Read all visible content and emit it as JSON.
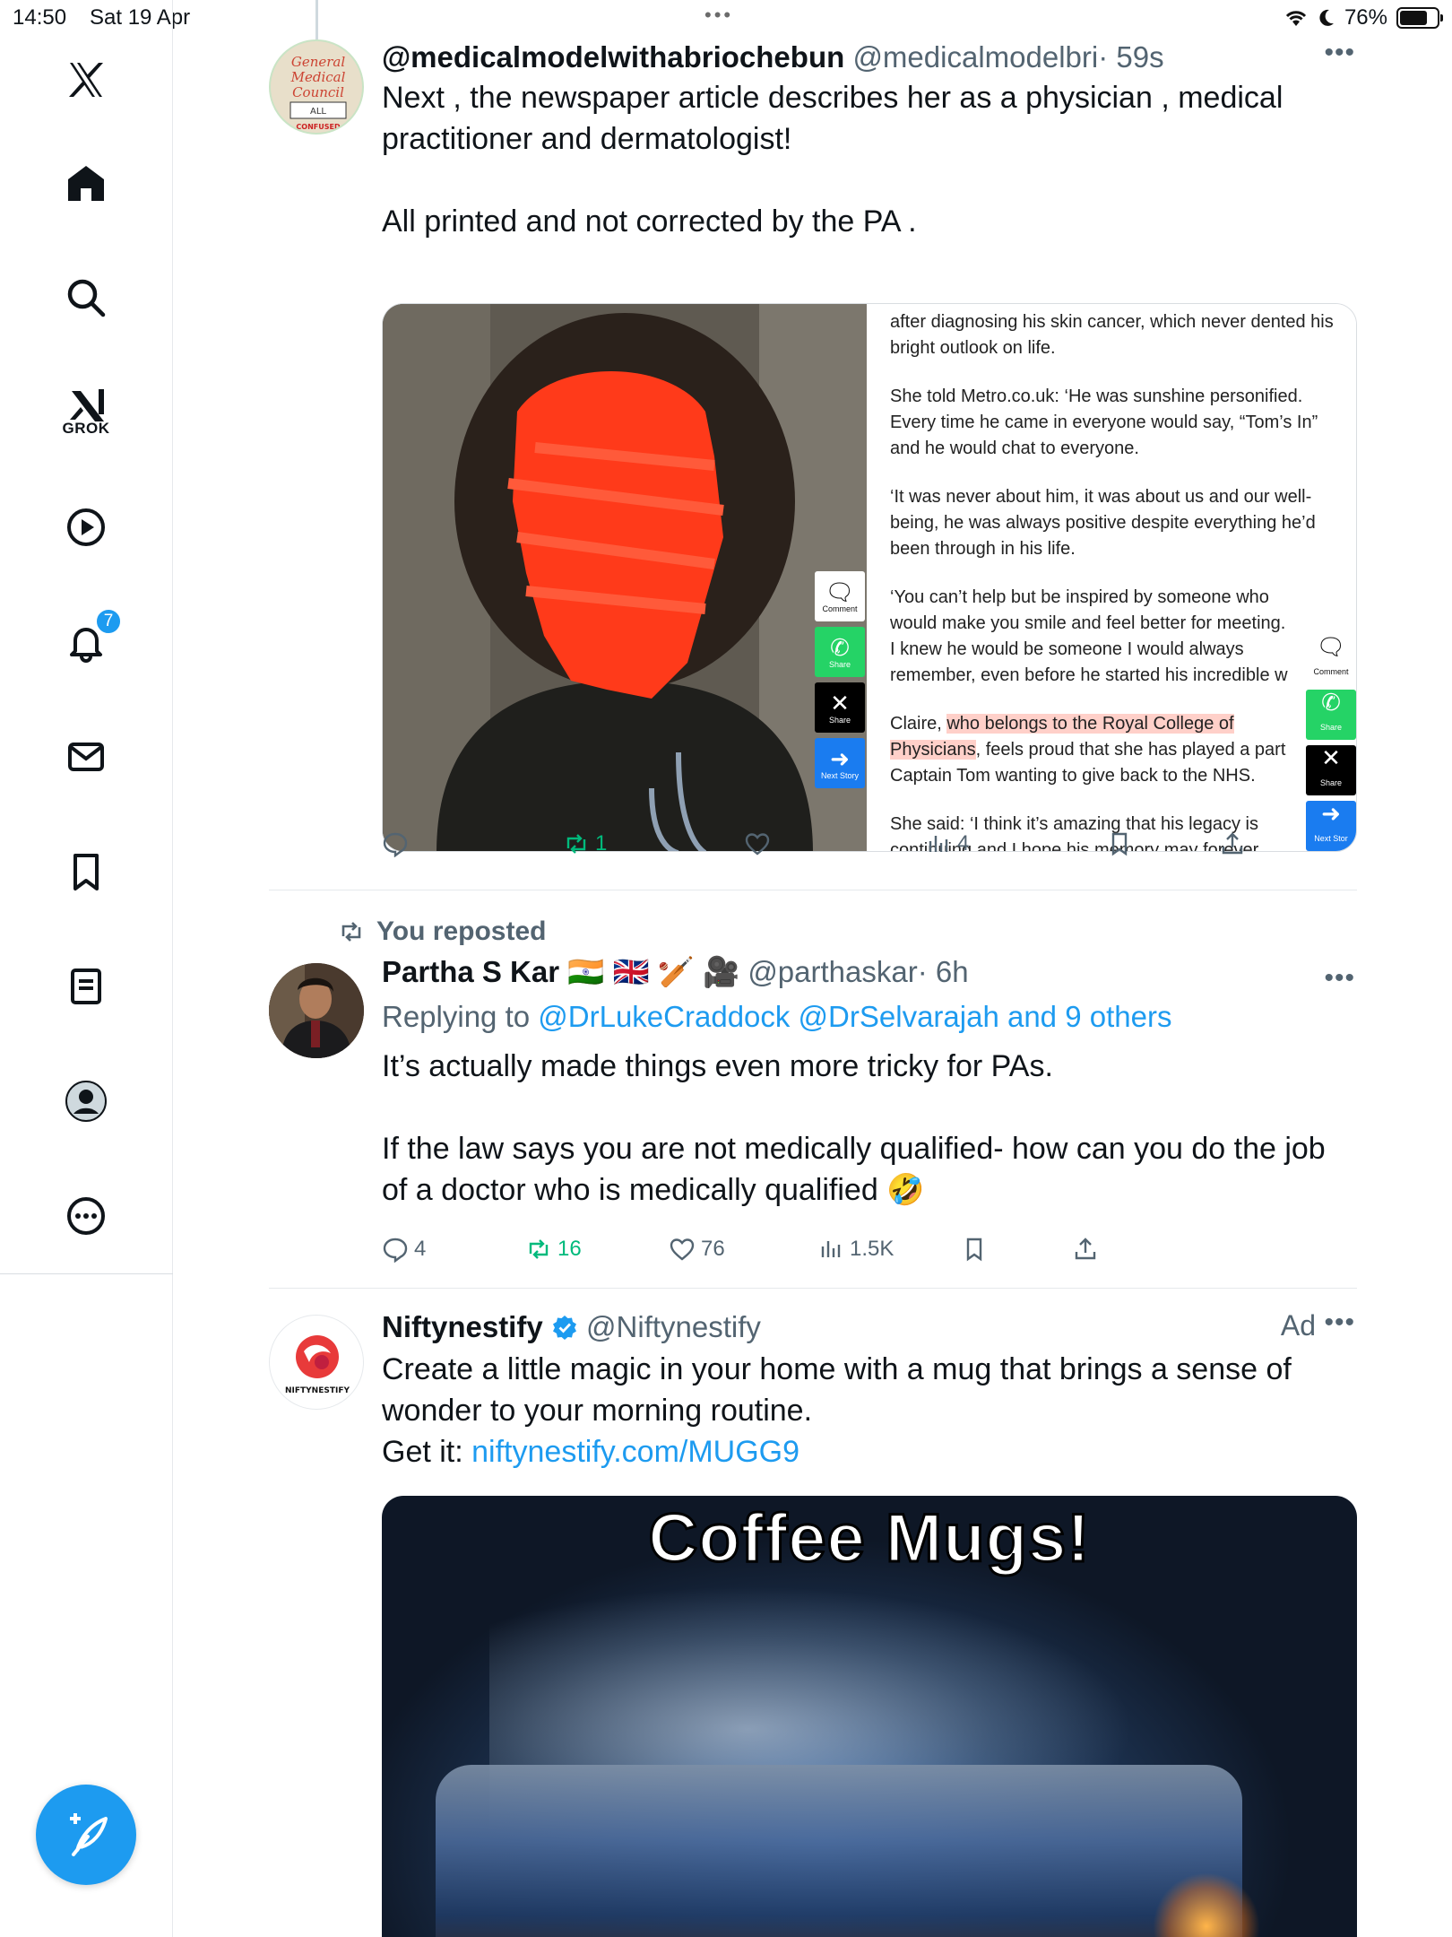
{
  "status_bar": {
    "time": "14:50",
    "date": "Sat 19 Apr",
    "battery": "76%",
    "battery_level": 0.76
  },
  "sidebar": {
    "grok_label": "GROK",
    "notifications_count": "7"
  },
  "tweets": [
    {
      "name": "@medicalmodelwithabriochebun",
      "handle": "@medicalmodelbri",
      "time": "· 59s",
      "text": "Next , the newspaper article describes her as a physician , medical practitioner and dermatologist!\n\nAll printed and not corrected by the PA .",
      "avatar_text": [
        "General",
        "Medical",
        "Council",
        "ALL",
        "CONFUSED"
      ],
      "article": {
        "p1": "after diagnosing his skin cancer, which never dented his bright outlook on life.",
        "p2": "She told Metro.co.uk: ‘He was sunshine personified. Every time he came in everyone would say, “Tom’s In” and he would chat to everyone.",
        "p3": "‘It was never about him, it was about us and our well-being, he was always positive despite everything he’d been through in his life.",
        "p4": "‘You can’t help but be inspired by someone who would make you smile and feel better for meeting. I knew he would be someone I would always remember, even before he started his incredible w",
        "p5a": "Claire, ",
        "p5b": "who belongs to the Royal College of Physicians",
        "p5c": ", feels proud that she has played a part Captain Tom wanting to give back to the NHS.",
        "p6": "She said: ‘I think it’s amazing that his legacy is continuing and I hope his memory may forever",
        "btn_comment": "Comment",
        "btn_share": "Share",
        "btn_next": "Next Story",
        "btn_next_cut": "Next Stor"
      },
      "stats": {
        "replies": "",
        "reposts": "1",
        "likes": "",
        "views": "4"
      }
    },
    {
      "repost_label": "You reposted",
      "name": "Partha S Kar",
      "flags": "🇮🇳 🇬🇧 🏏 🎥",
      "handle": "@parthaskar",
      "time": "· 6h",
      "replying_prefix": "Replying to",
      "replying_to": "@DrLukeCraddock @DrSelvarajah and 9 others",
      "text": "It’s actually made things even more tricky for PAs.\n\nIf the law says you are not medically qualified- how can you do the job of a doctor who is medically qualified 🤣",
      "stats": {
        "replies": "4",
        "reposts": "16",
        "likes": "76",
        "views": "1.5K"
      }
    },
    {
      "name": "Niftynestify",
      "handle": "@Niftynestify",
      "ad_label": "Ad",
      "avatar_text": "NIFTYNESTIFY",
      "text": "Create a little magic in your home with a mug that brings a sense of wonder to your morning routine.",
      "link_prefix": "Get it: ",
      "link": "niftynestify.com/MUGG9",
      "media_caption": "Coffee Mugs!"
    }
  ],
  "colors": {
    "accent": "#1d9bf0",
    "repost_green": "#00ba7c",
    "secondary_text": "#536471",
    "red_scribble": "#ff3a1a"
  }
}
